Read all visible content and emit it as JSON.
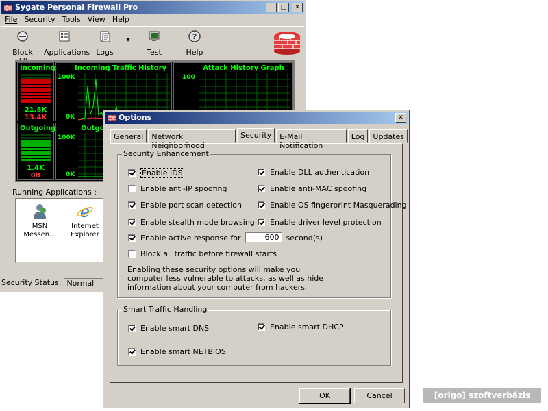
{
  "main_window": {
    "title": "Sygate Personal Firewall Pro",
    "controls": {
      "minimize": "_",
      "maximize": "□",
      "close": "✕"
    },
    "menu": [
      "File",
      "Security",
      "Tools",
      "View",
      "Help"
    ],
    "toolbar": [
      {
        "label": "Block All",
        "icon": "block-icon"
      },
      {
        "label": "Applications",
        "icon": "applications-icon"
      },
      {
        "label": "Logs",
        "icon": "logs-icon"
      },
      {
        "label": "Test",
        "icon": "test-icon"
      },
      {
        "label": "Help",
        "icon": "help-icon"
      }
    ],
    "logs_dropdown": "▾",
    "graphs": {
      "incoming": {
        "title": "Incoming",
        "val1": "21.8K",
        "val2": "13.4K"
      },
      "incoming_history": {
        "title": "Incoming Traffic History",
        "ymax": "100K",
        "ymin": "0K"
      },
      "attack_history": {
        "title": "Attack History Graph",
        "ymax": "100"
      },
      "outgoing": {
        "title": "Outgoing",
        "val1": "1.4K",
        "val2": "0B"
      },
      "outgoing_history": {
        "title": "Outgoing",
        "ymax": "100K",
        "ymin": "0K"
      }
    },
    "running_label": "Running Applications :",
    "apps": [
      {
        "line1": "MSN",
        "line2": "Messen..."
      },
      {
        "line1": "Internet",
        "line2": "Explorer"
      }
    ],
    "status": {
      "label": "Security Status:",
      "value": "Normal"
    }
  },
  "options_dialog": {
    "title": "Options",
    "close": "✕",
    "tabs": [
      "General",
      "Network Neighborhood",
      "Security",
      "E-Mail Notification",
      "Log",
      "Updates"
    ],
    "security_group": "Security Enhancement",
    "checks_left": [
      {
        "label": "Enable IDS",
        "checked": true
      },
      {
        "label": "Enable anti-IP spoofing",
        "checked": false
      },
      {
        "label": "Enable port scan detection",
        "checked": true
      },
      {
        "label": "Enable stealth mode browsing",
        "checked": true
      },
      {
        "label": "Enable active response for",
        "checked": true
      },
      {
        "label": "Block all traffic before firewall starts",
        "checked": false
      }
    ],
    "active_response_value": "600",
    "active_response_unit": "second(s)",
    "checks_right": [
      {
        "label": "Enable DLL authentication",
        "checked": true
      },
      {
        "label": "Enable anti-MAC spoofing",
        "checked": true
      },
      {
        "label": "Enable OS fingerprint Masquerading",
        "checked": true
      },
      {
        "label": "Enable driver level protection",
        "checked": true
      }
    ],
    "description": "Enabling these security options will make you computer less vulnerable to attacks, as well as hide information about your computer from hackers.",
    "smart_group": "Smart Traffic Handling",
    "smart_checks": [
      {
        "label": "Enable smart DNS",
        "checked": true
      },
      {
        "label": "Enable smart DHCP",
        "checked": true
      },
      {
        "label": "Enable smart NETBIOS",
        "checked": true
      }
    ],
    "ok": "OK",
    "cancel": "Cancel"
  },
  "watermark": "[origo] szoftverbázis",
  "colors": {
    "titlebar_start": "#0a246a",
    "titlebar_end": "#a6caf0",
    "face": "#d4d0c8",
    "graph_green": "#00ff00",
    "graph_red": "#cc0000"
  }
}
